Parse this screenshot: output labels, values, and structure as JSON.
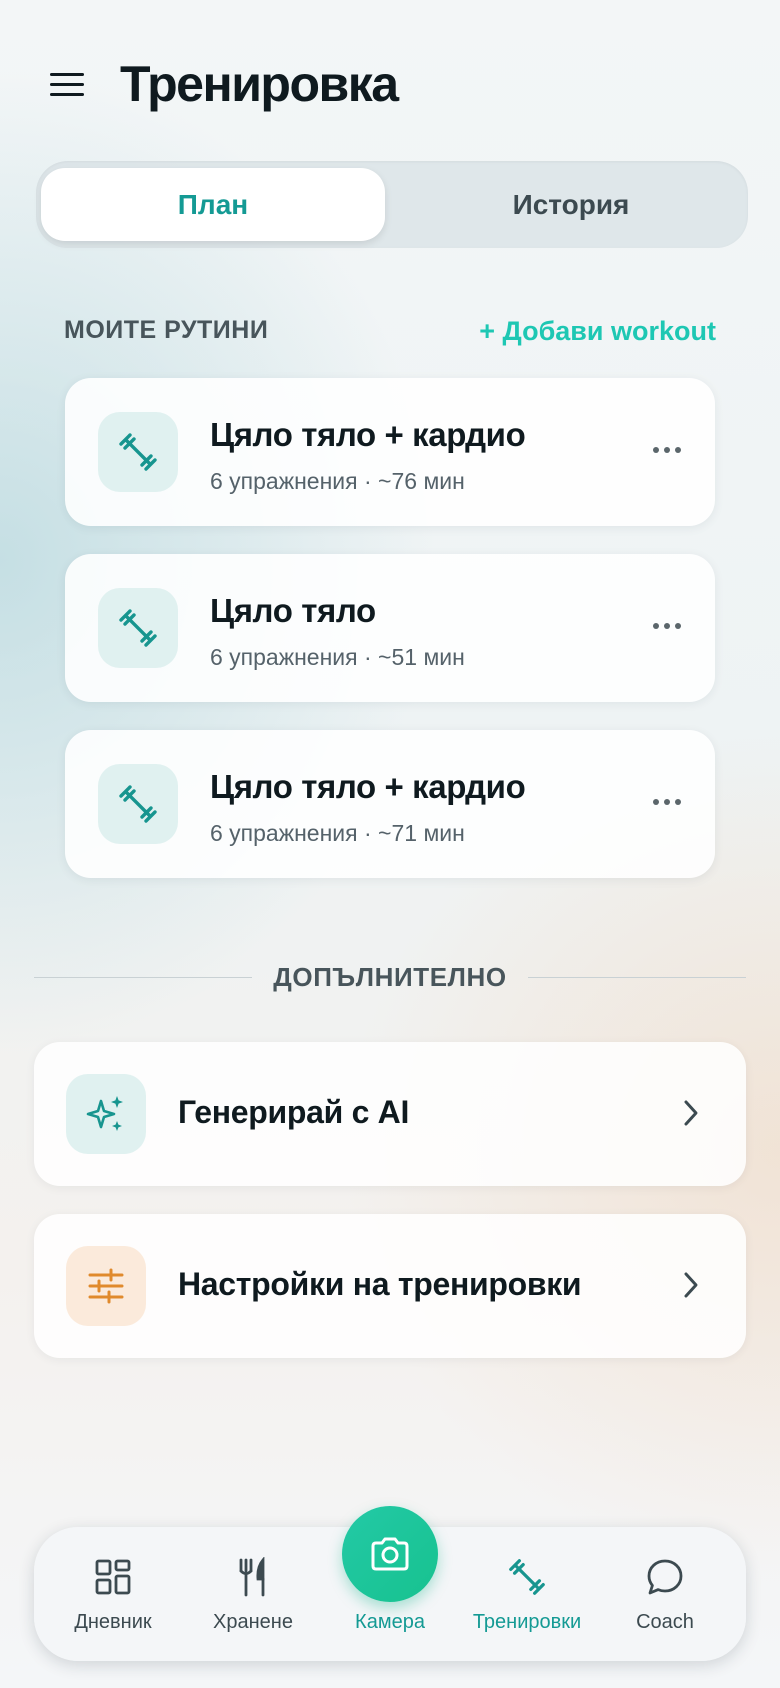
{
  "header": {
    "title": "Тренировка",
    "menu_icon": "menu-icon"
  },
  "tabs": [
    {
      "label": "План",
      "active": true
    },
    {
      "label": "История",
      "active": false
    }
  ],
  "routines": {
    "section_label": "МОИТЕ РУТИНИ",
    "add_label": "+ Добави workout",
    "items": [
      {
        "title": "Цяло тяло + кардио",
        "subtitle": "6 упражнения · ~76 мин",
        "icon": "dumbbell-icon"
      },
      {
        "title": "Цяло тяло",
        "subtitle": "6 упражнения · ~51 мин",
        "icon": "dumbbell-icon"
      },
      {
        "title": "Цяло тяло + кардио",
        "subtitle": "6 упражнения · ~71 мин",
        "icon": "dumbbell-icon"
      }
    ]
  },
  "extra": {
    "divider_label": "ДОПЪЛНИТЕЛНО",
    "items": [
      {
        "title": "Генерирай с AI",
        "icon": "sparkles-icon",
        "icon_bg": "#e0f1f0"
      },
      {
        "title": "Настройки на тренировки",
        "icon": "sliders-icon",
        "icon_bg": "#fbeadb"
      }
    ]
  },
  "nav": {
    "items": [
      {
        "label": "Дневник",
        "icon": "grid-icon"
      },
      {
        "label": "Хранене",
        "icon": "fork-knife-icon"
      },
      {
        "label": "Камера",
        "icon": "camera-icon"
      },
      {
        "label": "Тренировки",
        "icon": "dumbbell-icon",
        "active": true
      },
      {
        "label": "Coach",
        "icon": "chat-bubble-icon"
      }
    ]
  },
  "colors": {
    "accent": "#149a94",
    "accent_bright": "#1ec7b3",
    "camera_green": "#1fc69b",
    "orange_icon": "#e08a2c"
  }
}
